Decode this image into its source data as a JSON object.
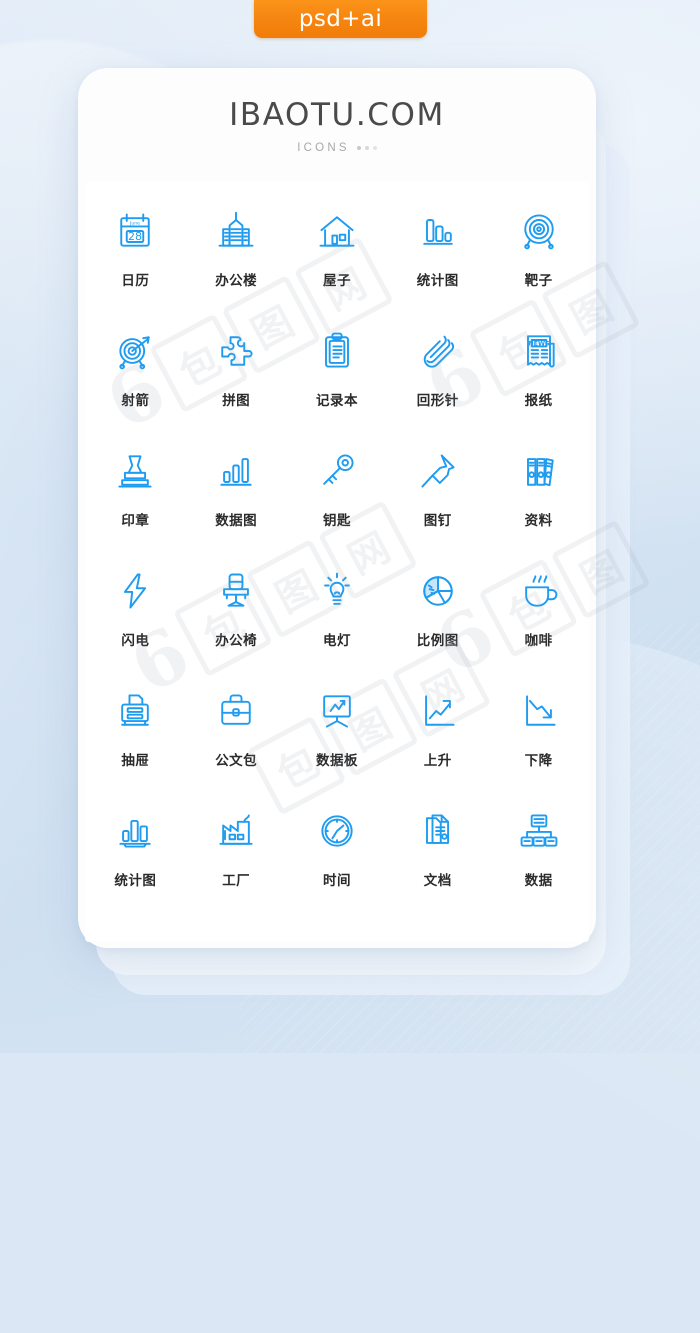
{
  "ribbon": {
    "label": "psd+ai",
    "color": "#f58410"
  },
  "header": {
    "brand": "IBAOTU.COM",
    "subtitle": "ICONS",
    "dots_count": 3
  },
  "theme": {
    "icon_color": "#1f9cf0",
    "label_color": "#2b2b2b",
    "card_color": "#fdfdfe",
    "background_color": "#d9e6f4"
  },
  "watermarks": [
    {
      "text": "6",
      "sub": "包图网"
    },
    {
      "text": "6",
      "sub": "包图网"
    },
    {
      "text": "6",
      "sub": "包图网"
    }
  ],
  "grid": {
    "columns": 5,
    "rows": 6,
    "items": [
      {
        "label": "日历",
        "icon": "calendar-icon",
        "note": "June 28"
      },
      {
        "label": "办公楼",
        "icon": "office-building-icon",
        "note": ""
      },
      {
        "label": "屋子",
        "icon": "house-icon",
        "note": ""
      },
      {
        "label": "统计图",
        "icon": "bar-chart-icon",
        "note": ""
      },
      {
        "label": "靶子",
        "icon": "target-icon",
        "note": ""
      },
      {
        "label": "射箭",
        "icon": "archery-target-arrow-icon",
        "note": ""
      },
      {
        "label": "拼图",
        "icon": "puzzle-piece-icon",
        "note": ""
      },
      {
        "label": "记录本",
        "icon": "clipboard-icon",
        "note": ""
      },
      {
        "label": "回形针",
        "icon": "paperclip-icon",
        "note": ""
      },
      {
        "label": "报纸",
        "icon": "newspaper-icon",
        "note": "NEWS"
      },
      {
        "label": "印章",
        "icon": "stamp-icon",
        "note": ""
      },
      {
        "label": "数据图",
        "icon": "bar-graph-icon",
        "note": ""
      },
      {
        "label": "钥匙",
        "icon": "key-icon",
        "note": ""
      },
      {
        "label": "图钉",
        "icon": "pushpin-icon",
        "note": ""
      },
      {
        "label": "资料",
        "icon": "binders-icon",
        "note": ""
      },
      {
        "label": "闪电",
        "icon": "lightning-bolt-icon",
        "note": ""
      },
      {
        "label": "办公椅",
        "icon": "office-chair-icon",
        "note": ""
      },
      {
        "label": "电灯",
        "icon": "lightbulb-icon",
        "note": ""
      },
      {
        "label": "比例图",
        "icon": "pie-chart-icon",
        "note": ""
      },
      {
        "label": "咖啡",
        "icon": "coffee-cup-icon",
        "note": ""
      },
      {
        "label": "抽屉",
        "icon": "drawer-printer-icon",
        "note": ""
      },
      {
        "label": "公文包",
        "icon": "briefcase-icon",
        "note": ""
      },
      {
        "label": "数据板",
        "icon": "presentation-board-icon",
        "note": ""
      },
      {
        "label": "上升",
        "icon": "trend-up-icon",
        "note": ""
      },
      {
        "label": "下降",
        "icon": "trend-down-icon",
        "note": ""
      },
      {
        "label": "统计图",
        "icon": "bar-chart-icon-2",
        "note": ""
      },
      {
        "label": "工厂",
        "icon": "factory-icon",
        "note": ""
      },
      {
        "label": "时间",
        "icon": "clock-icon",
        "note": ""
      },
      {
        "label": "文档",
        "icon": "document-icon",
        "note": ""
      },
      {
        "label": "数据",
        "icon": "data-hierarchy-icon",
        "note": ""
      }
    ]
  }
}
